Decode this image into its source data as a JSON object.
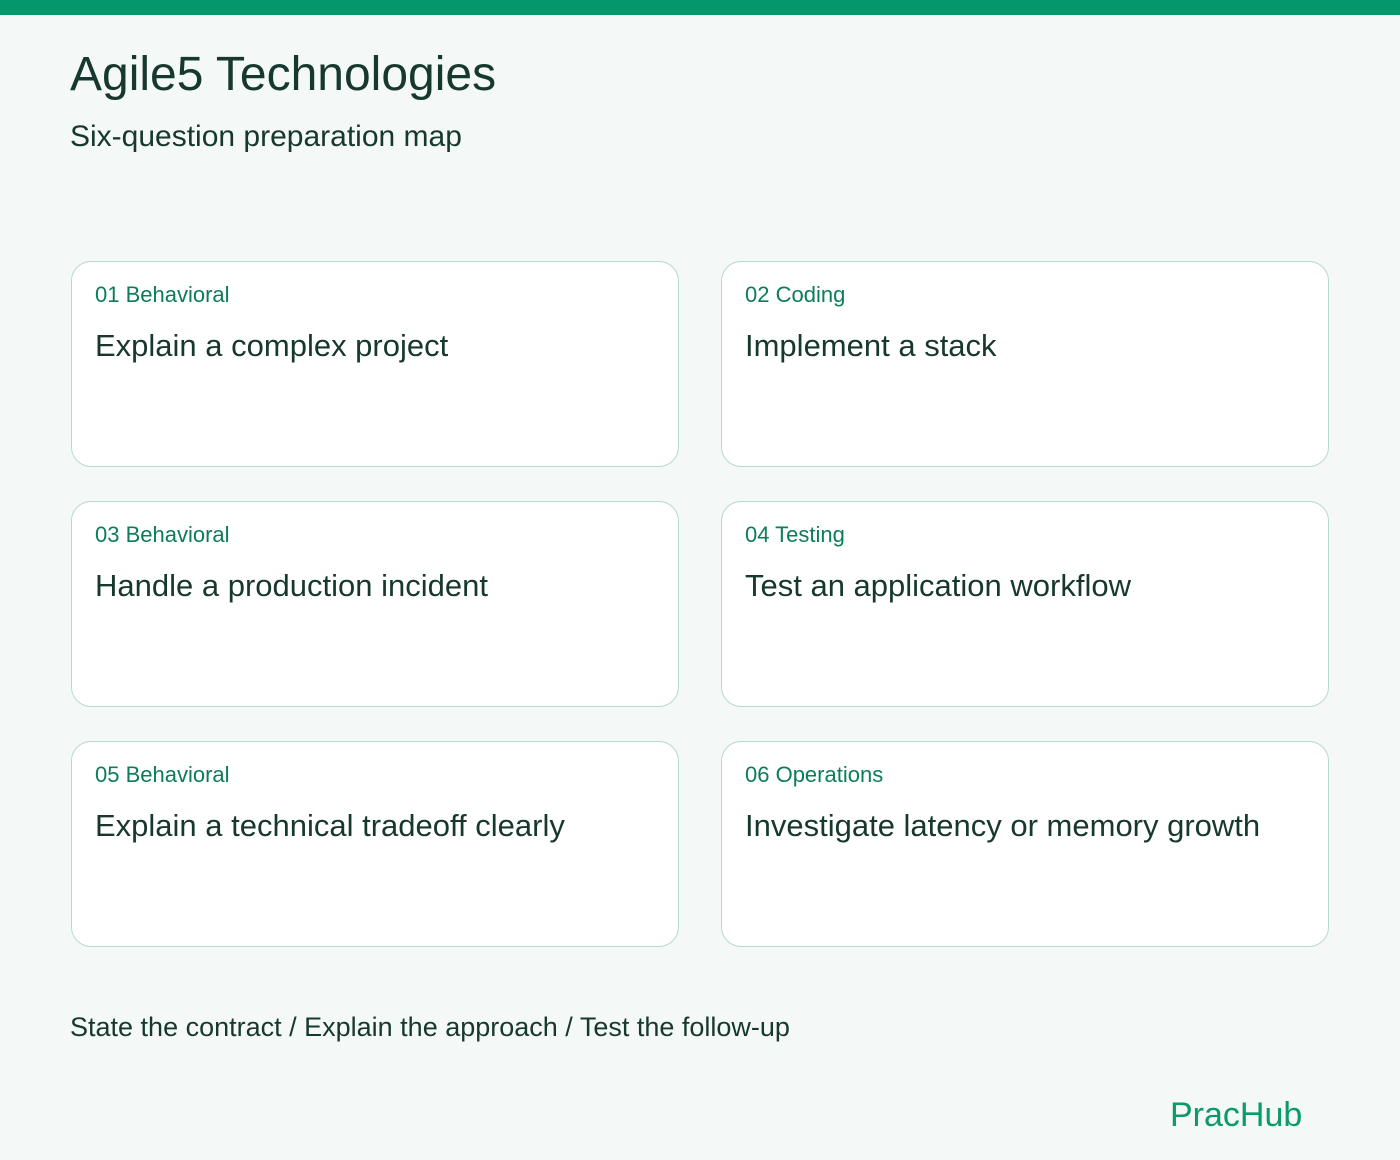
{
  "header": {
    "title": "Agile5 Technologies",
    "subtitle": "Six-question preparation map"
  },
  "cards": [
    {
      "tag": "01 Behavioral",
      "title": "Explain a complex project"
    },
    {
      "tag": "02 Coding",
      "title": "Implement a stack"
    },
    {
      "tag": "03 Behavioral",
      "title": "Handle a production incident"
    },
    {
      "tag": "04 Testing",
      "title": "Test an application workflow"
    },
    {
      "tag": "05 Behavioral",
      "title": "Explain a technical tradeoff clearly"
    },
    {
      "tag": "06 Operations",
      "title": "Investigate latency or memory growth"
    }
  ],
  "footer": {
    "tagline": "State the contract / Explain the approach / Test the follow-up",
    "brand": "PracHub"
  },
  "colors": {
    "accent": "#04976b",
    "tag_text": "#0b7d59",
    "text": "#17382f",
    "card_border": "#b7d8cd",
    "background": "#f4f8f6"
  }
}
